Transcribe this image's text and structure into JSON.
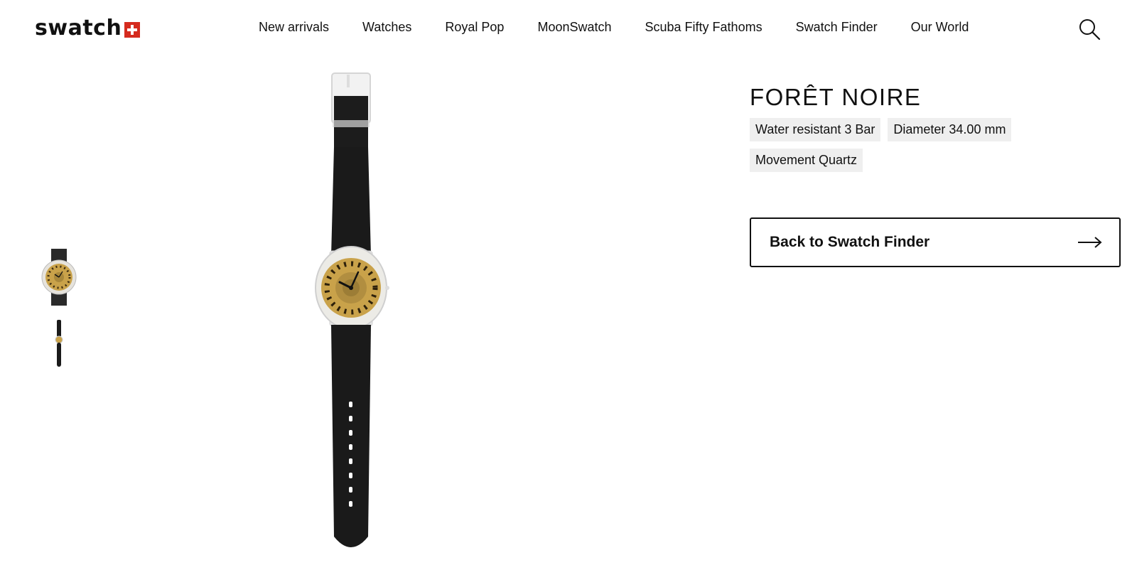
{
  "header": {
    "logo_text": "swatch",
    "nav": [
      {
        "label": "New arrivals"
      },
      {
        "label": "Watches"
      },
      {
        "label": "Royal Pop"
      },
      {
        "label": "MoonSwatch"
      },
      {
        "label": "Scuba Fifty Fathoms"
      },
      {
        "label": "Swatch Finder"
      },
      {
        "label": "Our World"
      }
    ],
    "search_icon": "search-icon"
  },
  "gallery": {
    "thumbnails": [
      {
        "icon": "watch-front-thumbnail"
      },
      {
        "icon": "watch-full-thumbnail"
      }
    ],
    "main_image": "watch-product-image"
  },
  "product": {
    "title": "FORÊT NOIRE",
    "tags": [
      {
        "label": "Water resistant 3 Bar"
      },
      {
        "label": "Diameter 34.00 mm"
      },
      {
        "label": "Movement Quartz"
      }
    ],
    "back_button": {
      "label": "Back to Swatch Finder",
      "icon": "arrow-right-icon"
    }
  },
  "colors": {
    "brand_red": "#d52b1e",
    "text": "#111111",
    "tag_bg": "#efefef",
    "strap": "#1a1a1a",
    "dial": "#c9a24a"
  }
}
